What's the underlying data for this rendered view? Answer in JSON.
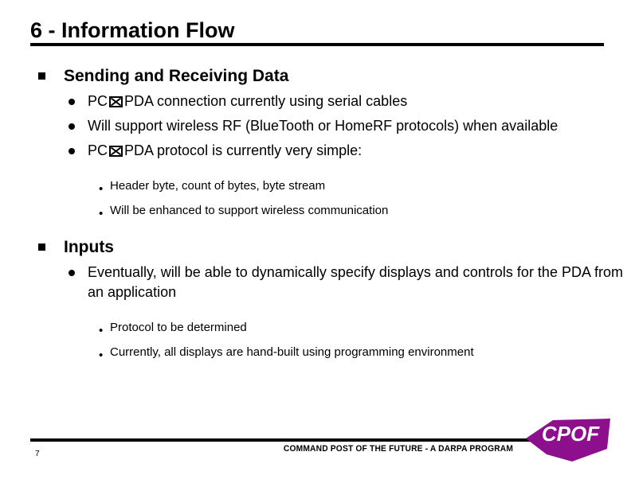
{
  "slide": {
    "title": "6 - Information Flow",
    "page_number": "7"
  },
  "sections": [
    {
      "heading": "Sending and Receiving Data",
      "bullets": [
        {
          "pre": "PC",
          "glyph": "boxed-x-icon",
          "post": "PDA connection currently using serial cables"
        },
        {
          "text": "Will support wireless RF (BlueTooth or HomeRF protocols) when available"
        },
        {
          "pre": "PC",
          "glyph": "boxed-x-icon",
          "post": "PDA protocol is currently very simple:"
        }
      ],
      "sub_bullets": [
        "Header byte, count of bytes, byte stream",
        "Will be enhanced to support wireless communication"
      ]
    },
    {
      "heading": "Inputs",
      "bullets": [
        {
          "text": "Eventually, will be able to dynamically specify displays and controls for the PDA from an application"
        }
      ],
      "sub_bullets": [
        "Protocol to be determined",
        "Currently, all displays are hand-built using programming environment"
      ]
    }
  ],
  "footer": {
    "tagline": "COMMAND POST OF THE FUTURE - A DARPA PROGRAM",
    "logo_text": "CPOF",
    "logo_color": "#8E0F8E"
  },
  "markers": {
    "level3_bullet": "•"
  }
}
